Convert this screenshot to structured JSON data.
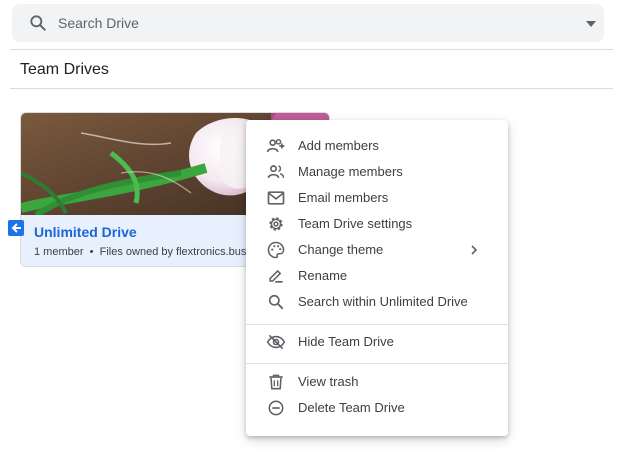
{
  "search": {
    "placeholder": "Search Drive",
    "value": ""
  },
  "page": {
    "title": "Team Drives"
  },
  "drive": {
    "name": "Unlimited Drive",
    "member_count": "1 member",
    "owner_text": "Files owned by flextronics.busi"
  },
  "context_menu": {
    "items": [
      {
        "label": "Add members",
        "icon": "add-members-icon"
      },
      {
        "label": "Manage members",
        "icon": "manage-members-icon"
      },
      {
        "label": "Email members",
        "icon": "email-icon"
      },
      {
        "label": "Team Drive settings",
        "icon": "gear-icon"
      },
      {
        "label": "Change theme",
        "icon": "palette-icon",
        "has_submenu": true
      },
      {
        "label": "Rename",
        "icon": "rename-icon"
      },
      {
        "label": "Search within Unlimited Drive",
        "icon": "search-icon"
      },
      {
        "label": "Hide Team Drive",
        "icon": "eye-off-icon"
      },
      {
        "label": "View trash",
        "icon": "trash-icon"
      },
      {
        "label": "Delete Team Drive",
        "icon": "minus-circle-icon"
      }
    ]
  },
  "colors": {
    "accent": "#1a73e8",
    "drive_name": "#1967d2",
    "card_bg": "#e8f0fe",
    "search_bg": "#f1f3f4"
  }
}
